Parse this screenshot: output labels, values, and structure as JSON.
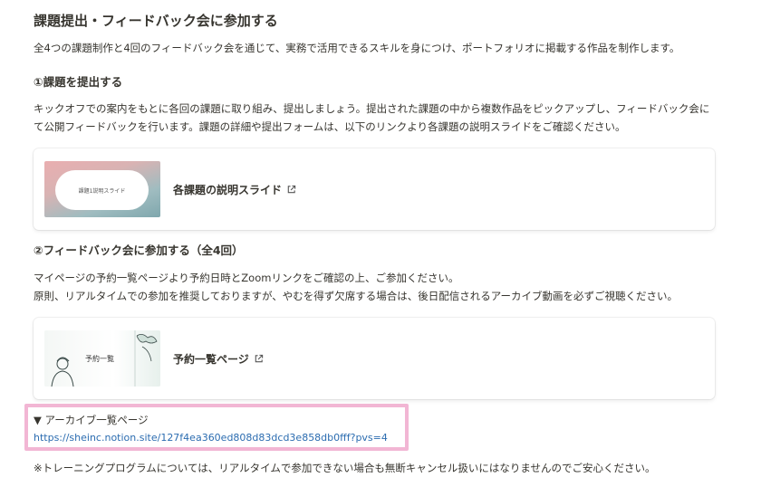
{
  "heading": "課題提出・フィードバック会に参加する",
  "intro": "全4つの課題制作と4回のフィードバック会を通じて、実務で活用できるスキルを身につけ、ポートフォリオに掲載する作品を制作します。",
  "section1": {
    "title": "①課題を提出する",
    "line1": "キックオフでの案内をもとに各回の課題に取り組み、提出しましょう。提出された課題の中から複数作品をピックアップし、フィードバック会に",
    "line2": "て公開フィードバックを行います。課題の詳細や提出フォームは、以下のリンクより各課題の説明スライドをご確認ください。",
    "card": {
      "thumb_text": "課題1説明スライド",
      "title": "各課題の説明スライド",
      "icon": "external-link-icon"
    }
  },
  "section2": {
    "title": "②フィードバック会に参加する（全4回）",
    "line1": "マイページの予約一覧ページより予約日時とZoomリンクをご確認の上、ご参加ください。",
    "line2": "原則、リアルタイムでの参加を推奨しておりますが、やむを得ず欠席する場合は、後日配信されるアーカイブ動画を必ずご視聴ください。",
    "card": {
      "thumb_text": "予約一覧",
      "title": "予約一覧ページ",
      "icon": "external-link-icon"
    }
  },
  "archive": {
    "toggle_label": "▼ アーカイブ一覧ページ",
    "link": "https://sheinc.notion.site/127f4ea360ed808d83dcd3e858db0fff?pvs=4"
  },
  "note": "※トレーニングプログラムについては、リアルタイムで参加できない場合も無断キャンセル扱いにはなりませんのでご安心ください。",
  "colors": {
    "text": "#37352f",
    "link": "#2b6cb0",
    "highlight": "#f2b6d4"
  }
}
